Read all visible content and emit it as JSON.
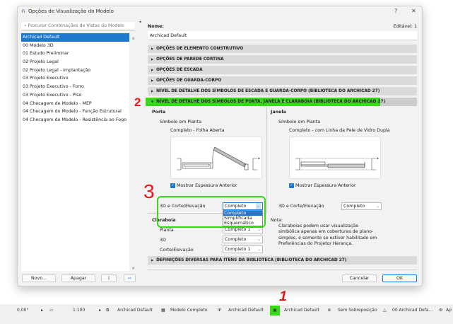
{
  "dialog": {
    "title": "Opções de Visualização do Modelo",
    "help": "?",
    "close": "✕"
  },
  "left": {
    "search_placeholder": "Procurar Combinações de Vistas do Modelo",
    "items": [
      "Archicad Default",
      "00 Modelo 3D",
      "01 Estudo Preliminar",
      "02 Projeto Legal",
      "02 Projeto Legal - Implantação",
      "03 Projeto Executivo",
      "03 Projeto Executivo - Forro",
      "03 Projeto Executivo - Piso",
      "04 Checagem de Modelo - MEP",
      "04 Checagem do Modelo - Função Estrutural",
      "04 Checagem do Modelo - Resistência ao Fogo"
    ],
    "new_label": "Novo...",
    "delete_label": "Apagar"
  },
  "right": {
    "name_label": "Nome:",
    "editable": "Editável: 1",
    "name_value": "Archicad Default",
    "sections": [
      "OPÇÕES DE ELEMENTO CONSTRUTIVO",
      "OPÇÕES DE PAREDE CORTINA",
      "OPÇÕES DE ESCADA",
      "OPÇÕES DE GUARDA-CORPO",
      "NÍVEL DE DETALHE DOS SÍMBOLOS DE ESCADA E GUARDA-CORPO (BIBLIOTECA DO ARCHICAD 27)",
      "NÍVEL DE DETALHE DOS SÍMBOLOS DE PORTA, JANELA E CLARABOIA (BIBLIOTECA DO ARCHICAD 27)"
    ],
    "door": {
      "title": "Porta",
      "plan_symbol": "Símbolo em Planta",
      "plan_value": "Completo - Folha Aberta",
      "show_thickness": "Mostrar Espessura Anterior",
      "section_label": "3D e Corte/Elevação",
      "section_value": "Completo",
      "options": [
        "Completo",
        "Simplificada",
        "Esquemático"
      ]
    },
    "window": {
      "title": "Janela",
      "plan_symbol": "Símbolo em Planta",
      "plan_value": "Completo - com Linha da Pele de Vidro Dupla",
      "show_thickness": "Mostrar Espessura Anterior",
      "section_label": "3D e Corte/Elevação",
      "section_value": "Completo"
    },
    "skylight": {
      "title": "Claraboia",
      "plan_label": "Planta",
      "plan_value": "Completo 1",
      "3d_label": "3D",
      "3d_value": "Completo",
      "section_label": "Corte/Elevação",
      "section_value": "Completo 1"
    },
    "note": {
      "title": "Nota:",
      "text": "Claraboias podem usar visualização simbólica apenas em coberturas de plano-simples, e somente se estiver habilitado em Preferências do Projeto/ Herança."
    },
    "misc_section": "DEFINIÇÕES DIVERSAS PARA ITENS DA BIBLIOTECA (BIBLIOTECA DO ARCHICAD 27)",
    "cancel_label": "Cancelar",
    "ok_label": "OK"
  },
  "annotations": {
    "one": "1",
    "two": "2",
    "three": "3"
  },
  "statusbar": {
    "angle": "0,00°",
    "scale": "1:100",
    "layers": "Archicad Default",
    "model": "Modelo Completo",
    "pen": "Archicad Default",
    "mvo": "Archicad Default",
    "override": "Sem Sobreposição",
    "dim": "00 Archicad Defa...",
    "last": "Ap"
  },
  "colors": {
    "accent": "#1e78d2",
    "highlight": "#38d818",
    "annotation": "#e81818"
  }
}
